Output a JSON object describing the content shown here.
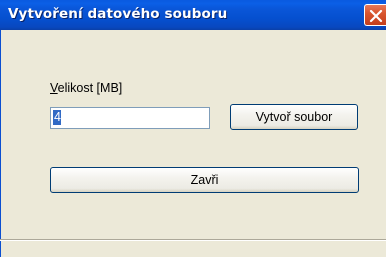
{
  "window": {
    "title": "Vytvoření datového souboru"
  },
  "form": {
    "size_label_accel": "V",
    "size_label_rest": "elikost [MB]",
    "size_value": "4",
    "create_button_label": "Vytvoř soubor",
    "close_button_label": "Zavři"
  },
  "colors": {
    "titlebar": "#0a56d8",
    "close_button": "#d9562f",
    "background": "#ece9d8",
    "selection": "#316ac5"
  },
  "icons": {
    "close": "close-icon"
  }
}
